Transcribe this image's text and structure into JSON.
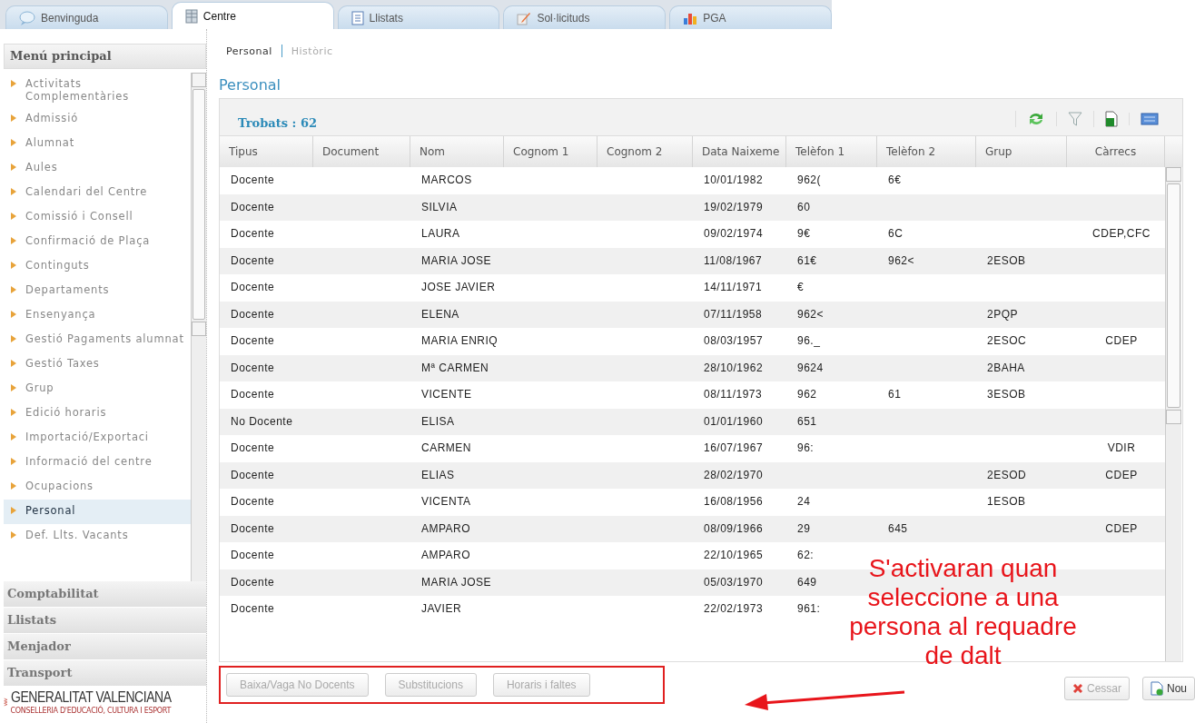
{
  "tabs": [
    {
      "label": "Benvinguda",
      "kind": "chat",
      "selected": false
    },
    {
      "label": "Centre",
      "kind": "grid",
      "selected": true
    },
    {
      "label": "Llistats",
      "kind": "list",
      "selected": false
    },
    {
      "label": "Sol·licituds",
      "kind": "pencil",
      "selected": false
    },
    {
      "label": "PGA",
      "kind": "chart",
      "selected": false
    }
  ],
  "sidebar": {
    "title": "Menú principal",
    "items": [
      {
        "label": "Activitats Complementàries",
        "selected": false
      },
      {
        "label": "Admissió",
        "selected": false
      },
      {
        "label": "Alumnat",
        "selected": false
      },
      {
        "label": "Aules",
        "selected": false
      },
      {
        "label": "Calendari del Centre",
        "selected": false
      },
      {
        "label": "Comissió i Consell",
        "selected": false
      },
      {
        "label": "Confirmació de Plaça",
        "selected": false
      },
      {
        "label": "Continguts",
        "selected": false
      },
      {
        "label": "Departaments",
        "selected": false
      },
      {
        "label": "Ensenyança",
        "selected": false
      },
      {
        "label": "Gestió Pagaments alumnat",
        "selected": false
      },
      {
        "label": "Gestió Taxes",
        "selected": false
      },
      {
        "label": "Grup",
        "selected": false
      },
      {
        "label": "Edició horaris",
        "selected": false
      },
      {
        "label": "Importació/Exportaci",
        "selected": false
      },
      {
        "label": "Informació del centre",
        "selected": false
      },
      {
        "label": "Ocupacions",
        "selected": false
      },
      {
        "label": "Personal",
        "selected": true
      },
      {
        "label": "Def. Llts. Vacants",
        "selected": false
      }
    ],
    "sections": [
      "Comptabilitat",
      "Llistats",
      "Menjador",
      "Transport"
    ],
    "logo": {
      "name": "GENERALITAT VALENCIANA",
      "subtitle": "CONSELLERIA D'EDUCACIÓ, CULTURA I ESPORT"
    }
  },
  "subtabs": [
    {
      "label": "Personal",
      "selected": true
    },
    {
      "label": "Històric",
      "selected": false
    }
  ],
  "page_title": "Personal",
  "found": "Trobats : 62",
  "table": {
    "columns": [
      "Tipus",
      "Document",
      "Nom",
      "Cognom 1",
      "Cognom 2",
      "Data Naixeme",
      "Telèfon 1",
      "Telèfon 2",
      "Grup",
      "Càrrecs"
    ],
    "rows": [
      [
        "Docente",
        "",
        "MARCOS",
        "",
        "",
        "10/01/1982",
        "962(",
        "6€",
        "",
        ""
      ],
      [
        "Docente",
        "",
        "SILVIA",
        "",
        "",
        "19/02/1979",
        "60",
        "",
        "",
        ""
      ],
      [
        "Docente",
        "",
        "LAURA",
        "",
        "",
        "09/02/1974",
        "9€",
        "6C",
        "",
        "CDEP,CFC"
      ],
      [
        "Docente",
        "",
        "MARIA JOSE",
        "",
        "",
        "11/08/1967",
        "61€",
        "962<",
        "2ESOB",
        ""
      ],
      [
        "Docente",
        "",
        "JOSE JAVIER",
        "",
        "",
        "14/11/1971",
        "€",
        "",
        "",
        ""
      ],
      [
        "Docente",
        "",
        "ELENA",
        "",
        "",
        "07/11/1958",
        "962<",
        "",
        "2PQP",
        ""
      ],
      [
        "Docente",
        "",
        "MARIA ENRIQ",
        "",
        "",
        "08/03/1957",
        "96._",
        "",
        "2ESOC",
        "CDEP"
      ],
      [
        "Docente",
        "",
        "Mª CARMEN",
        "",
        "",
        "28/10/1962",
        "9624",
        "",
        "2BAHA",
        ""
      ],
      [
        "Docente",
        "",
        "VICENTE",
        "",
        "",
        "08/11/1973",
        "962",
        "61",
        "3ESOB",
        ""
      ],
      [
        "No Docente",
        "",
        "ELISA",
        "",
        "",
        "01/01/1960",
        "651",
        "",
        "",
        ""
      ],
      [
        "Docente",
        "",
        "CARMEN",
        "",
        "",
        "16/07/1967",
        "96:",
        "",
        "",
        "VDIR"
      ],
      [
        "Docente",
        "",
        "ELIAS",
        "",
        "",
        "28/02/1970",
        "",
        "",
        "2ESOD",
        "CDEP"
      ],
      [
        "Docente",
        "",
        "VICENTA",
        "",
        "",
        "16/08/1956",
        "24",
        "",
        "1ESOB",
        ""
      ],
      [
        "Docente",
        "",
        "AMPARO",
        "",
        "",
        "08/09/1966",
        "29",
        "645",
        "",
        "CDEP"
      ],
      [
        "Docente",
        "",
        "AMPARO",
        "",
        "",
        "22/10/1965",
        "62:",
        "",
        "",
        ""
      ],
      [
        "Docente",
        "",
        "MARIA JOSE",
        "",
        "",
        "05/03/1970",
        "649",
        "",
        "",
        ""
      ],
      [
        "Docente",
        "",
        "JAVIER",
        "",
        "",
        "22/02/1973",
        "961:",
        "",
        "",
        ""
      ]
    ]
  },
  "action_buttons": [
    {
      "label": "Baixa/Vaga No Docents",
      "disabled": true
    },
    {
      "label": "Substitucions",
      "disabled": true
    },
    {
      "label": "Horaris i faltes",
      "disabled": true
    }
  ],
  "right_buttons": [
    {
      "label": "Cessar",
      "kind": "cancel",
      "disabled": true
    },
    {
      "label": "Nou",
      "kind": "new",
      "disabled": false
    }
  ],
  "annotation": "S'activaran quan seleccione a una persona al requadre de dalt"
}
